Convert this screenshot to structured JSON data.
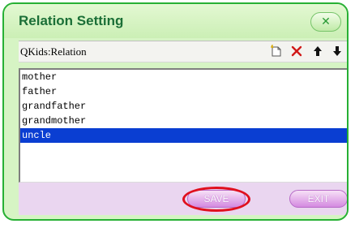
{
  "dialog": {
    "title": "Relation Setting",
    "close_symbol": "✕"
  },
  "toolbar": {
    "label": "QKids:Relation",
    "icons": [
      "new-item-icon",
      "delete-icon",
      "move-up-icon",
      "move-down-icon"
    ]
  },
  "list": {
    "items": [
      "mother",
      "father",
      "grandfather",
      "grandmother",
      "uncle"
    ],
    "selected": "uncle"
  },
  "buttons": {
    "save_label": "SAVE",
    "exit_label": "EXIT"
  },
  "colors": {
    "border_green": "#27b034",
    "panel_green": "#d6f4c4",
    "title_green": "#1b6f37",
    "selection_blue": "#0a3ed2",
    "footer_pink": "#ead6f0",
    "button_purple": "#d48ae0",
    "highlight_red": "#e0101e"
  }
}
